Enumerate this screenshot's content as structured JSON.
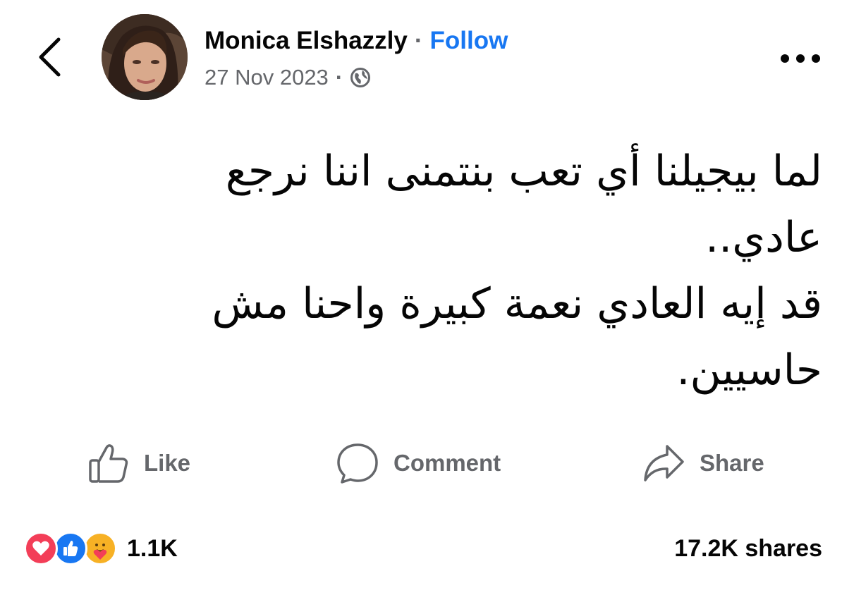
{
  "post": {
    "author_name": "Monica Elshazzly",
    "name_separator": "·",
    "follow_label": "Follow",
    "date": "27 Nov 2023",
    "meta_separator": "·",
    "privacy_icon": "globe-icon",
    "text_lines": [
      "لما بيجيلنا أي تعب بنتمنى اننا نرجع",
      "عادي..",
      "قد إيه العادي نعمة كبيرة واحنا مش",
      "حاسيين."
    ]
  },
  "actions": {
    "like_label": "Like",
    "comment_label": "Comment",
    "share_label": "Share"
  },
  "stats": {
    "reactions": [
      "love",
      "like",
      "care"
    ],
    "reaction_count": "1.1K",
    "shares": "17.2K shares"
  },
  "colors": {
    "accent": "#1877f2",
    "muted": "#65676b",
    "text": "#050505",
    "love": "#f33e58",
    "care": "#f7b125"
  }
}
